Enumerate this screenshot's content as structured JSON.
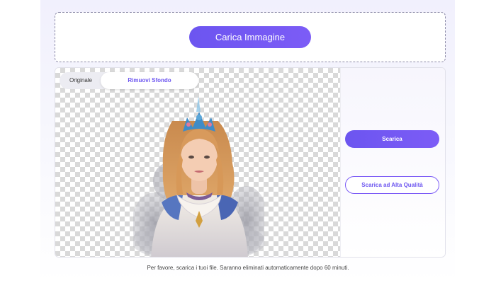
{
  "upload": {
    "button_label": "Carica Immagine"
  },
  "editor": {
    "tabs": [
      {
        "label": "Originale",
        "active": false
      },
      {
        "label": "Rimuovi Sfondo",
        "active": true
      }
    ],
    "preview": {
      "subject": "woman-with-crown-cutout",
      "background": "transparent-checkerboard"
    }
  },
  "actions": {
    "download_label": "Scarica",
    "download_hq_label": "Scarica ad Alta Qualità"
  },
  "footer": {
    "note": "Per favore, scarica i tuoi file. Saranno eliminati automaticamente dopo 60 minuti."
  },
  "colors": {
    "accent": "#6c55f0",
    "accent_light": "#7c5cf6",
    "panel_bg": "#f1f0fd"
  }
}
